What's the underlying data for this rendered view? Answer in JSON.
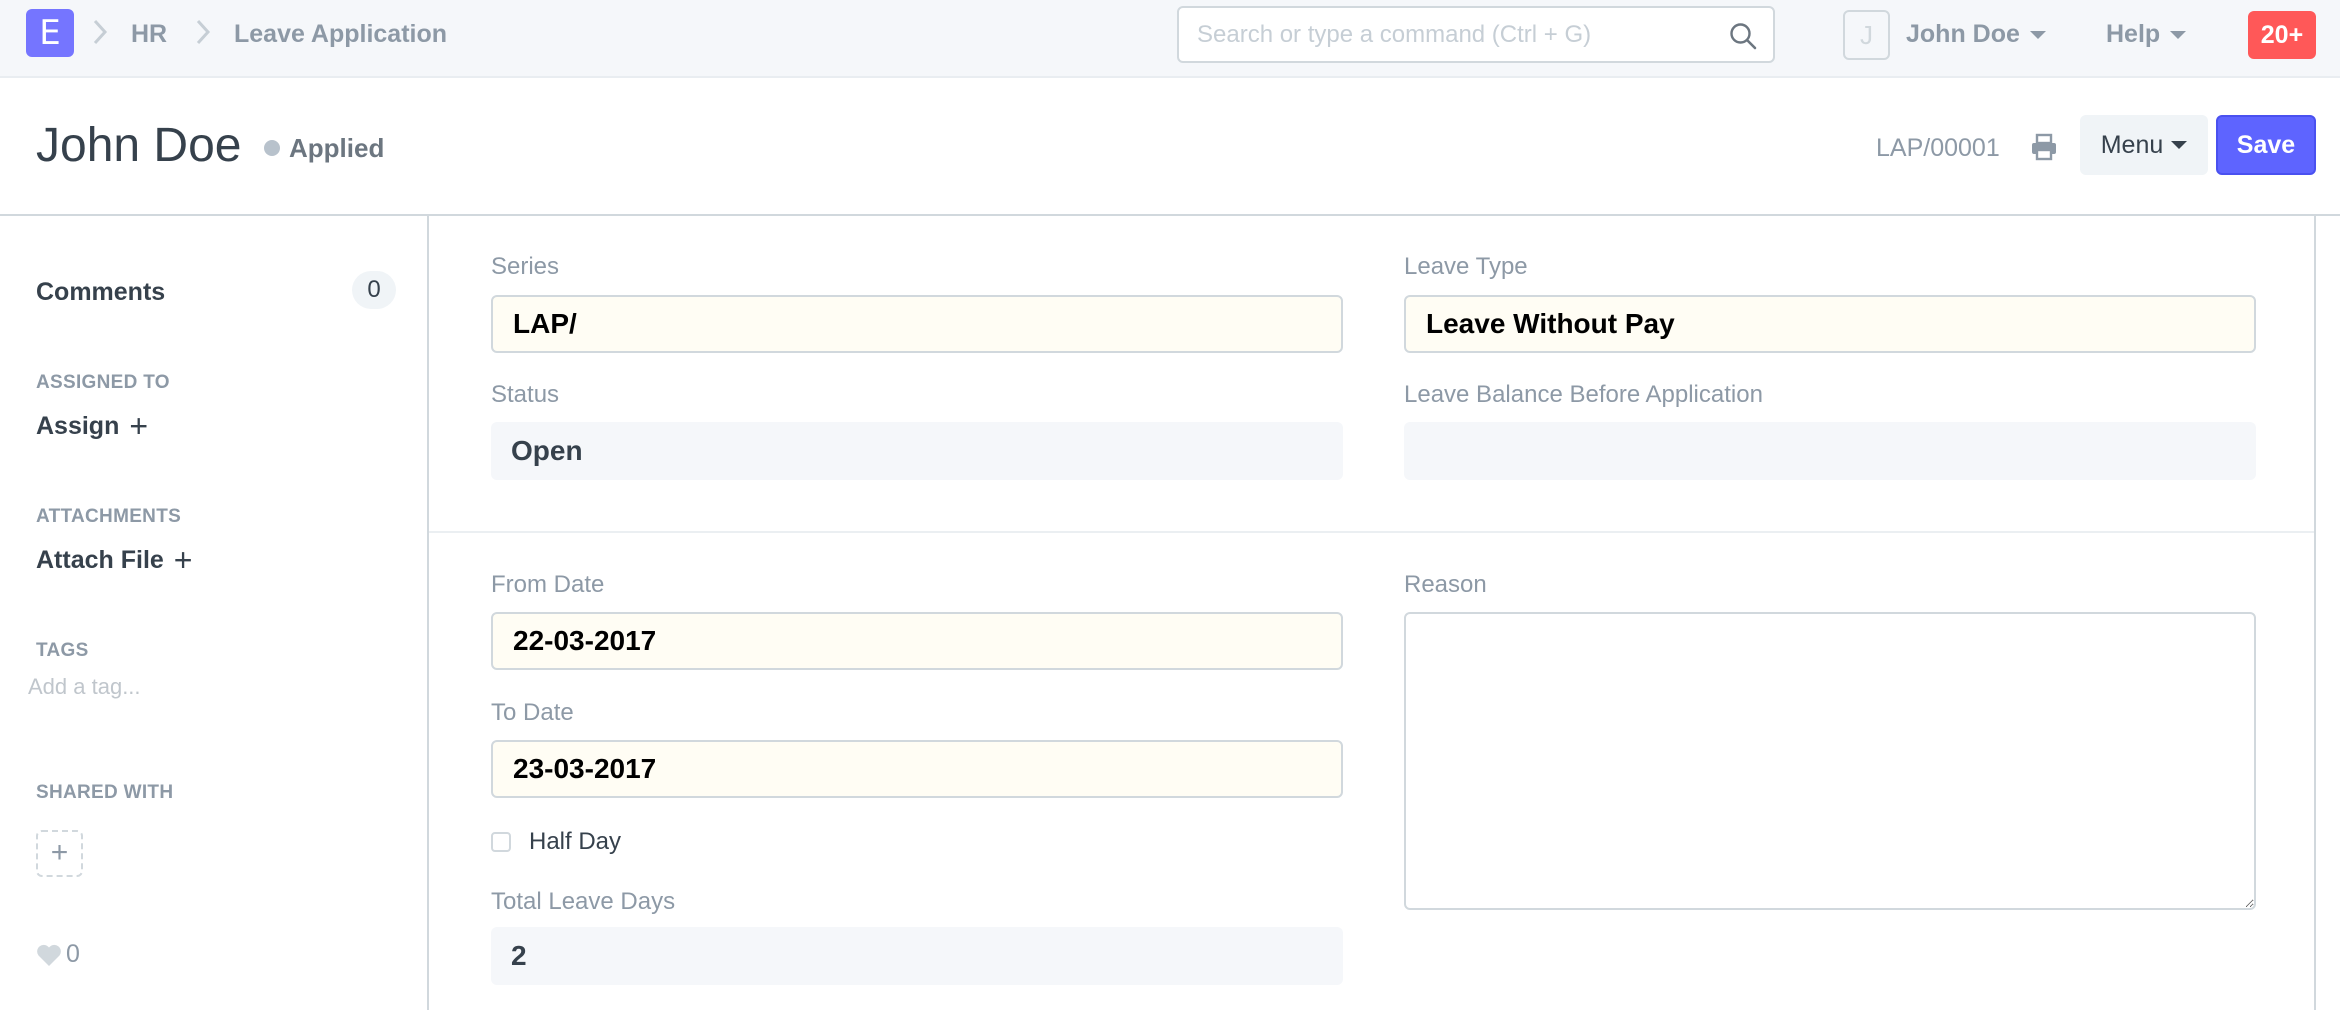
{
  "navbar": {
    "logo_letter": "E",
    "breadcrumbs": [
      "HR",
      "Leave Application"
    ],
    "search_placeholder": "Search or type a command (Ctrl + G)",
    "search_value": "",
    "avatar_initial": "J",
    "user_name": "John Doe",
    "help_label": "Help",
    "notification_badge": "20+"
  },
  "page_head": {
    "title": "John Doe",
    "status": "Applied",
    "doc_name": "LAP/00001",
    "menu_label": "Menu",
    "save_label": "Save"
  },
  "sidebar": {
    "comments_label": "Comments",
    "comments_count": "0",
    "assigned_to_label": "ASSIGNED TO",
    "assign_action": "Assign",
    "attachments_label": "ATTACHMENTS",
    "attach_action": "Attach File",
    "tags_label": "TAGS",
    "tags_placeholder": "Add a tag...",
    "shared_with_label": "SHARED WITH",
    "likes_count": "0"
  },
  "form": {
    "series": {
      "label": "Series",
      "value": "LAP/"
    },
    "leave_type": {
      "label": "Leave Type",
      "value": "Leave Without Pay"
    },
    "status": {
      "label": "Status",
      "value": "Open"
    },
    "leave_balance": {
      "label": "Leave Balance Before Application",
      "value": ""
    },
    "from_date": {
      "label": "From Date",
      "value": "22-03-2017"
    },
    "to_date": {
      "label": "To Date",
      "value": "23-03-2017"
    },
    "half_day": {
      "label": "Half Day",
      "checked": false
    },
    "total_leave_days": {
      "label": "Total Leave Days",
      "value": "2"
    },
    "reason": {
      "label": "Reason",
      "value": ""
    }
  },
  "colors": {
    "brand": "#7575ff",
    "primary_button": "#5e64ff",
    "badge": "#ff5858",
    "muted_text": "#8d99a6",
    "mandatory_field_bg": "#fffdf4"
  }
}
